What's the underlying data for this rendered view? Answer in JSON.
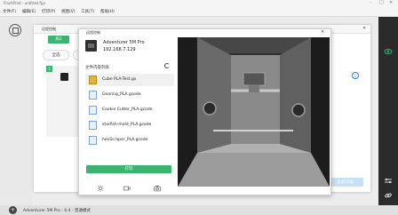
{
  "app": {
    "title": "FlashPrint - untitled.fpp",
    "window_controls": [
      "–",
      "□",
      "✕"
    ]
  },
  "menu": [
    "文件(F)",
    "编辑(E)",
    "打印(P)",
    "视图(V)",
    "工具(T)",
    "帮助(H)"
  ],
  "background_dialog": {
    "title": "远程控制",
    "tab": "局1",
    "select_label": "全选",
    "card_tag": "1",
    "send_button": "发送G代码"
  },
  "dialog": {
    "title": "远程控制",
    "printer_name": "Adventurer 5M Pro",
    "printer_ip": "192.168.7.129",
    "file_list_title": "文件内容列表",
    "files": [
      {
        "name": "Cube PLA-Test.gx",
        "thumb": "cube",
        "selected": true
      },
      {
        "name": "Gearing_PLA.gcode",
        "thumb": "doc",
        "selected": false
      },
      {
        "name": "Cookie Cutter_PLA.gcode",
        "thumb": "doc",
        "selected": false
      },
      {
        "name": "starfish-mold_PLA.gcode",
        "thumb": "doc",
        "selected": false
      },
      {
        "name": "hexScraper_PLA.gcode",
        "thumb": "doc",
        "selected": false
      }
    ],
    "print_button": "打印",
    "controls": [
      "light-icon",
      "camera-icon",
      "snapshot-icon"
    ]
  },
  "status_bar": {
    "text": "Adventurer 5M Pro - 0.4 - 普通模式"
  },
  "colors": {
    "accent_green": "#3cb371",
    "right_bar": "#2b2b2b",
    "info_blue": "#2a7ae2"
  }
}
